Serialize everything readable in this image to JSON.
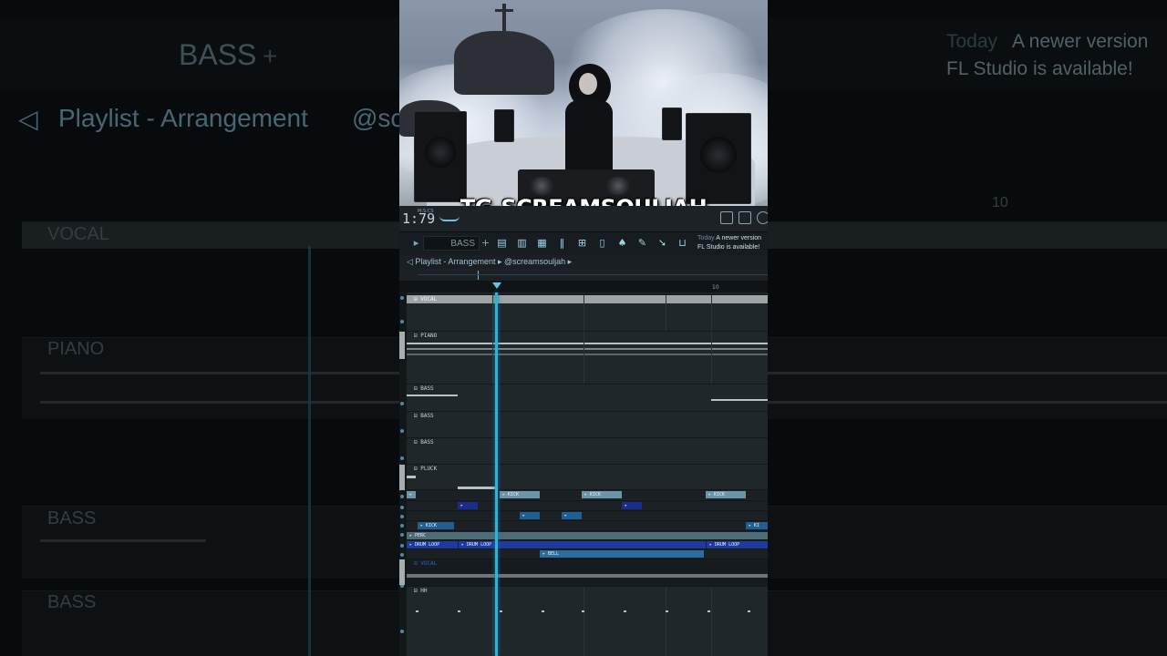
{
  "background": {
    "pattern_label": "BASS",
    "playlist_title": "Playlist - Arrangement",
    "playlist_owner": "@sc",
    "notice_today": "Today",
    "notice_line1": "A newer version",
    "notice_line2": "FL Studio is available!",
    "tracks": [
      "VOCAL",
      "PIANO",
      "BASS",
      "BASS"
    ],
    "bar_number": "10"
  },
  "video": {
    "caption": "TG-SCREAMSOULJAH"
  },
  "fl": {
    "time": "1:79",
    "time_label": "M:S:CS",
    "pattern_label": "BASS",
    "notice_today": "Today",
    "notice_line1": "A newer version",
    "notice_line2": "FL Studio is available!",
    "playlist_title": "Playlist - Arrangement",
    "playlist_owner": "@screamsouljah",
    "bar_number": "10",
    "tracks": [
      {
        "label": "VOCAL"
      },
      {
        "label": "PIANO"
      },
      {
        "label": "BASS"
      },
      {
        "label": "BASS"
      },
      {
        "label": "BASS"
      },
      {
        "label": "PLUCK"
      },
      {
        "label": "PERC"
      },
      {
        "label": "VOCAL"
      },
      {
        "label": "HH"
      }
    ],
    "clips": {
      "kick": "KICK",
      "drum_loop": "DRUM LOOP",
      "bell": "BELL",
      "perc": "PERC",
      "kick_short": "KI"
    }
  }
}
